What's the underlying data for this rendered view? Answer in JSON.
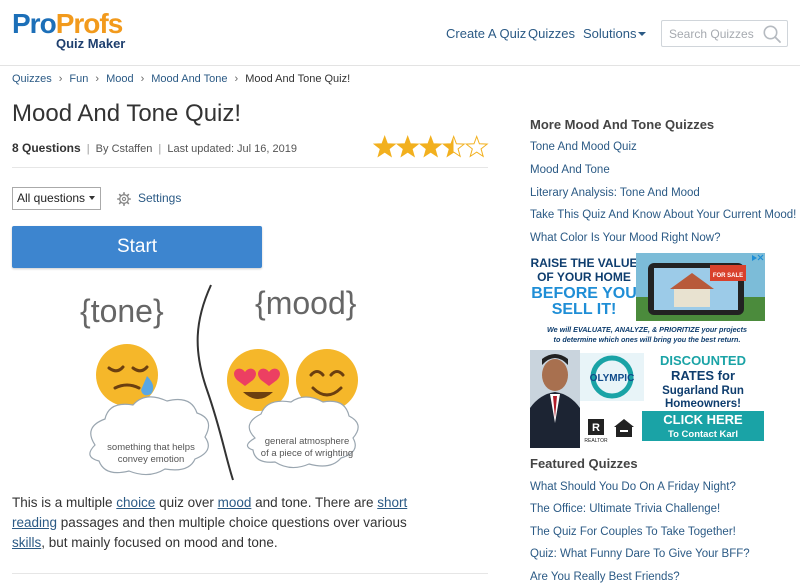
{
  "header": {
    "logo_pro": "Pro",
    "logo_profs": "Profs",
    "logo_sub": "Quiz Maker",
    "nav": {
      "create": "Create A Quiz",
      "quizzes": "Quizzes",
      "solutions": "Solutions"
    },
    "search_placeholder": "Search Quizzes"
  },
  "breadcrumb": [
    "Quizzes",
    "Fun",
    "Mood",
    "Mood And Tone",
    "Mood And Tone Quiz!"
  ],
  "breadcrumb_sep": "›",
  "quiz": {
    "title": "Mood And Tone Quiz!",
    "question_count": "8 Questions",
    "meta": "By Cstaffen",
    "updated": "Last updated: Jul 16, 2019",
    "meta_sep": "|",
    "rating": 3.5,
    "rating_max": 5,
    "filter_value": "All questions",
    "settings_label": "Settings",
    "start_label": "Start"
  },
  "illustration": {
    "tone_word": "{tone}",
    "mood_word": "{mood}",
    "tone_caption_1": "something that helps",
    "tone_caption_2": "convey emotion",
    "mood_caption_1": "general atmosphere",
    "mood_caption_2": "of a piece of wrighting"
  },
  "description": {
    "p1": "This is a multiple ",
    "link1": "choice",
    "p2": " quiz over ",
    "link2": "mood",
    "p3": " and tone. There are ",
    "link3": "short reading",
    "p4": " passages and then multiple choice questions over various ",
    "link4": "skills",
    "p5": ", but mainly focused on mood and tone."
  },
  "sidebar": {
    "more_heading": "More Mood And Tone Quizzes",
    "more_links": [
      "Tone And Mood Quiz",
      "Mood And Tone",
      "Literary Analysis: Tone And Mood",
      "Take This Quiz And Know About Your Current Mood!",
      "What Color Is Your Mood Right Now?"
    ],
    "featured_heading": "Featured Quizzes",
    "featured_links": [
      "What Should You Do On A Friday Night?",
      "The Office: Ultimate Trivia Challenge!",
      "The Quiz For Couples To Take Together!",
      "Quiz: What Funny Dare To Give Your BFF?",
      "Are You Really Best Friends?"
    ]
  },
  "ad": {
    "line1": "RAISE THE VALUE",
    "line2": "OF YOUR HOME",
    "line3": "BEFORE YOU",
    "line4": "SELL IT!",
    "body1": "We will EVALUATE, ANALYZE, & PRIORITIZE your projects",
    "body2": "to determine which ones will bring you the best return.",
    "offer1": "DISCOUNTED",
    "offer2": "RATES for",
    "offer3": "Sugarland Run",
    "offer4": "Homeowners!",
    "cta1": "CLICK HERE",
    "cta2": "To Contact Karl",
    "brand": "OLYMPIC",
    "sign_text": "FOR SALE",
    "realtor_label": "REALTOR"
  },
  "colors": {
    "link": "#2b5a85",
    "brand_blue": "#1c6fb8",
    "brand_orange": "#f29a1c",
    "button": "#3d85cf",
    "star": "#f2b01e",
    "ad_navy": "#0e4a8a",
    "ad_teal": "#1aa3a6"
  }
}
